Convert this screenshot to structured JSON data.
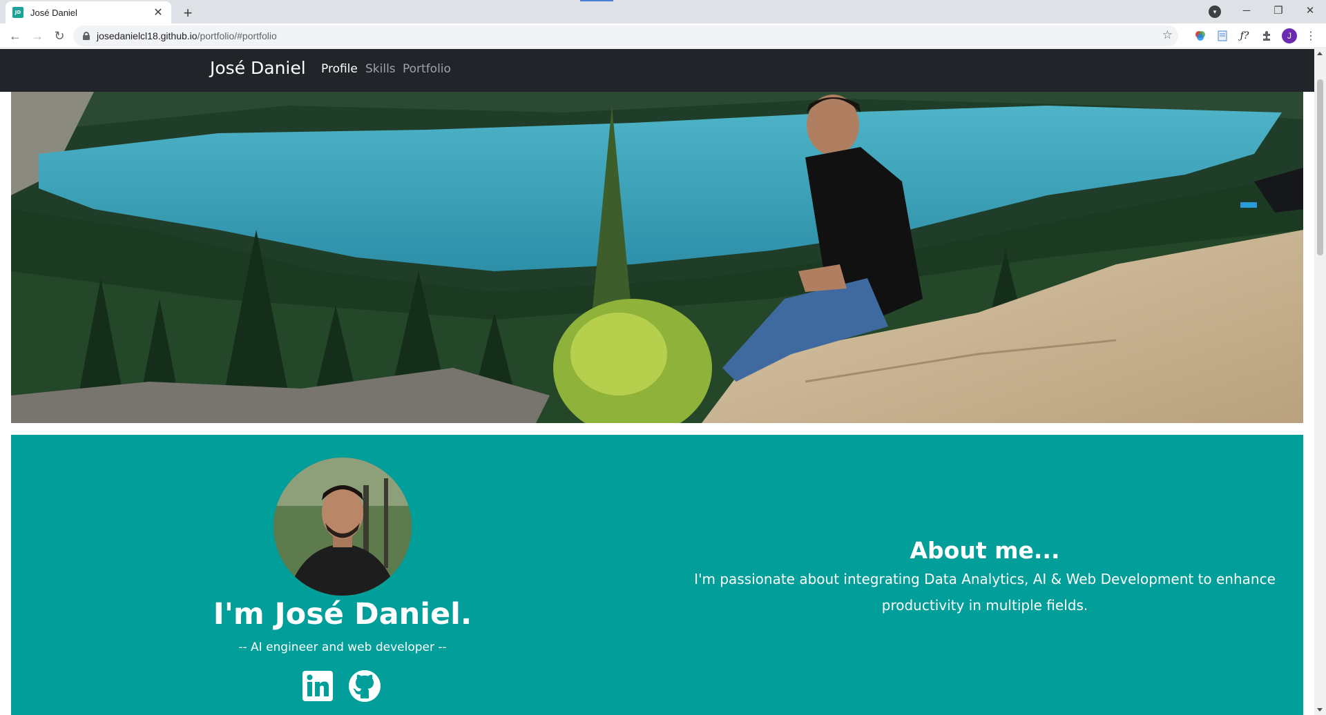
{
  "browser": {
    "tab_title": "José Daniel",
    "favicon_text": "JD",
    "url_host": "josedanielcl18.github.io",
    "url_path": "/portfolio/#portfolio",
    "profile_initial": "J"
  },
  "nav": {
    "brand": "José Daniel",
    "links": [
      "Profile",
      "Skills",
      "Portfolio"
    ],
    "active": "Profile"
  },
  "about": {
    "greeting": "I'm José Daniel.",
    "tagline": "-- AI engineer and web developer --",
    "title": "About me...",
    "text": "I'm passionate about integrating Data Analytics, AI & Web Development to enhance productivity in multiple fields."
  },
  "social": {
    "icons": [
      "linkedin-icon",
      "github-icon"
    ]
  },
  "colors": {
    "navbar": "#212529",
    "teal": "#029e99",
    "lake": "#3fa9c0"
  }
}
